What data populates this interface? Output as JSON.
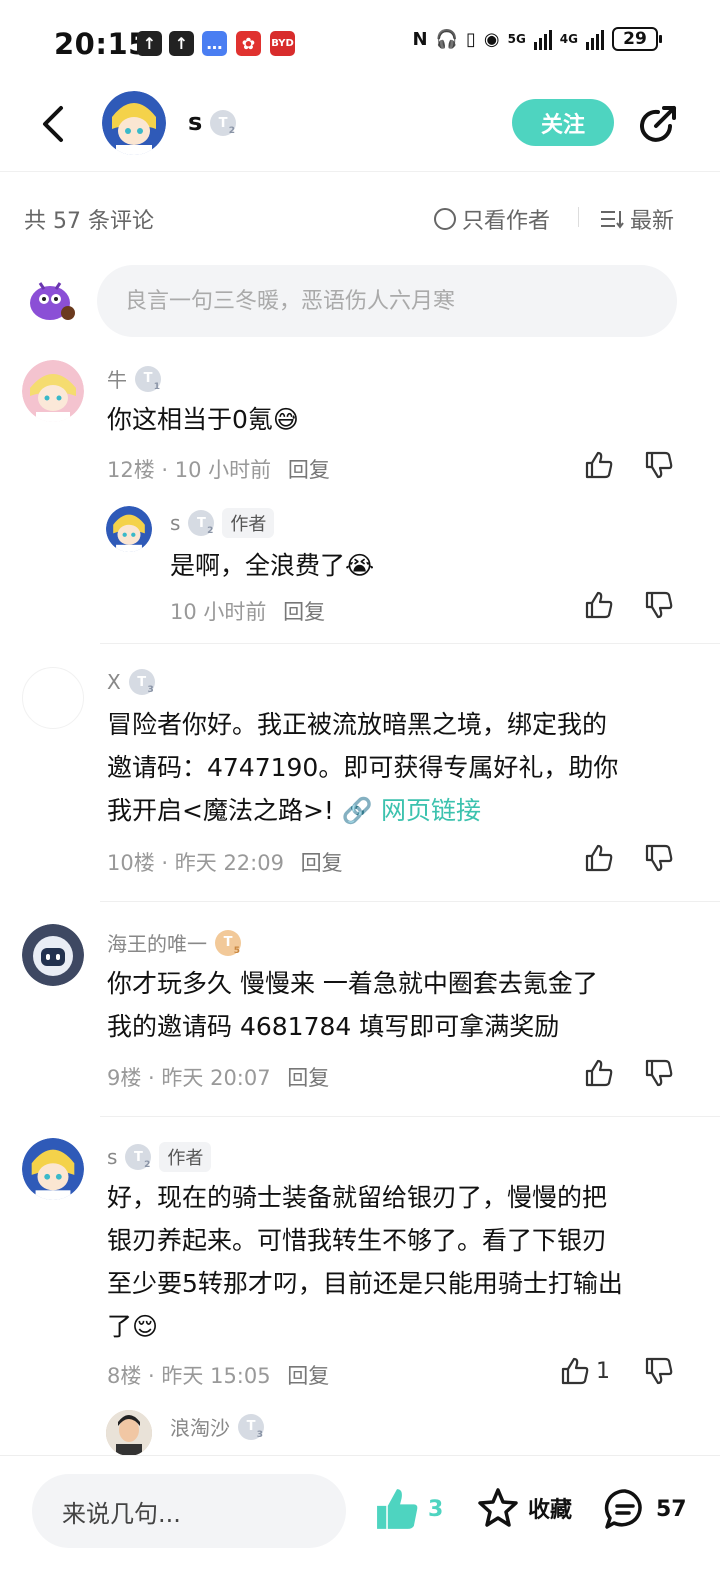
{
  "status_bar": {
    "time": "20:15",
    "network_1": "5G",
    "network_2": "4G",
    "battery": "29"
  },
  "header": {
    "name": "s",
    "level": "2",
    "follow_label": "关注"
  },
  "comments_header": {
    "count_label": "共 57 条评论",
    "only_author_label": "只看作者",
    "sort_label": "最新"
  },
  "composer": {
    "placeholder": "良言一句三冬暖，恶语伤人六月寒"
  },
  "comments": [
    {
      "name": "牛",
      "level": "1",
      "text": "你这相当于0氪",
      "floor": "12楼",
      "time": "10 小时前",
      "reply_label": "回复",
      "replies": [
        {
          "name": "s",
          "level": "2",
          "author_tag": "作者",
          "text": "是啊，全浪费了",
          "time": "10 小时前",
          "reply_label": "回复"
        }
      ]
    },
    {
      "name": "X",
      "level": "3",
      "text_lines": [
        "冒险者你好。我正被流放暗黑之境，绑定我的",
        "邀请码：4747190。即可获得专属好礼，助你",
        "我开启<魔法之路>!"
      ],
      "link_label": "网页链接",
      "floor": "10楼",
      "time": "昨天 22:09",
      "reply_label": "回复"
    },
    {
      "name": "海王的唯一",
      "level": "5",
      "text_lines": [
        "你才玩多久  慢慢来 一着急就中圈套去氪金了",
        "我的邀请码 4681784  填写即可拿满奖励"
      ],
      "floor": "9楼",
      "time": "昨天 20:07",
      "reply_label": "回复"
    },
    {
      "name": "s",
      "level": "2",
      "author_tag": "作者",
      "text_lines": [
        "好，现在的骑士装备就留给银刃了，慢慢的把",
        "银刃养起来。可惜我转生不够了。看了下银刃",
        "至少要5转那才叼，目前还是只能用骑士打输出",
        "了"
      ],
      "floor": "8楼",
      "time": "昨天 15:05",
      "reply_label": "回复",
      "likes": "1",
      "replies": [
        {
          "name": "浪淘沙",
          "level": "3"
        }
      ]
    }
  ],
  "bottom_bar": {
    "input_label": "来说几句...",
    "like_count": "3",
    "fav_label": "收藏",
    "comment_count": "57"
  },
  "colors": {
    "accent": "#4ed4c0",
    "link": "#3cc2ae",
    "muted": "#999999"
  }
}
